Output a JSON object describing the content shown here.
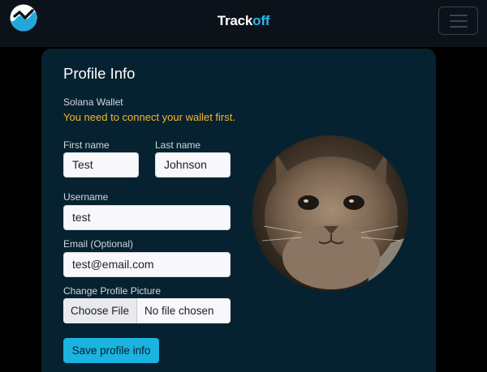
{
  "navbar": {
    "brand_part1": "Track",
    "brand_part2": "off",
    "logo_icon": "wave-chart-logo",
    "menu_icon": "hamburger-menu-icon"
  },
  "profile": {
    "title": "Profile Info",
    "wallet_label": "Solana Wallet",
    "wallet_warning": "You need to connect your wallet first.",
    "first_name_label": "First name",
    "first_name_value": "Test",
    "last_name_label": "Last name",
    "last_name_value": "Johnson",
    "username_label": "Username",
    "username_value": "test",
    "email_label": "Email (Optional)",
    "email_value": "test@email.com",
    "picture_label": "Change Profile Picture",
    "file_button": "Choose File",
    "file_status": "No file chosen",
    "save_button": "Save profile info",
    "avatar_icon": "cat-avatar"
  },
  "colors": {
    "brand_accent": "#2bb6e8",
    "warning": "#f4b72c",
    "button": "#1bb3e0",
    "card": "#062231"
  }
}
